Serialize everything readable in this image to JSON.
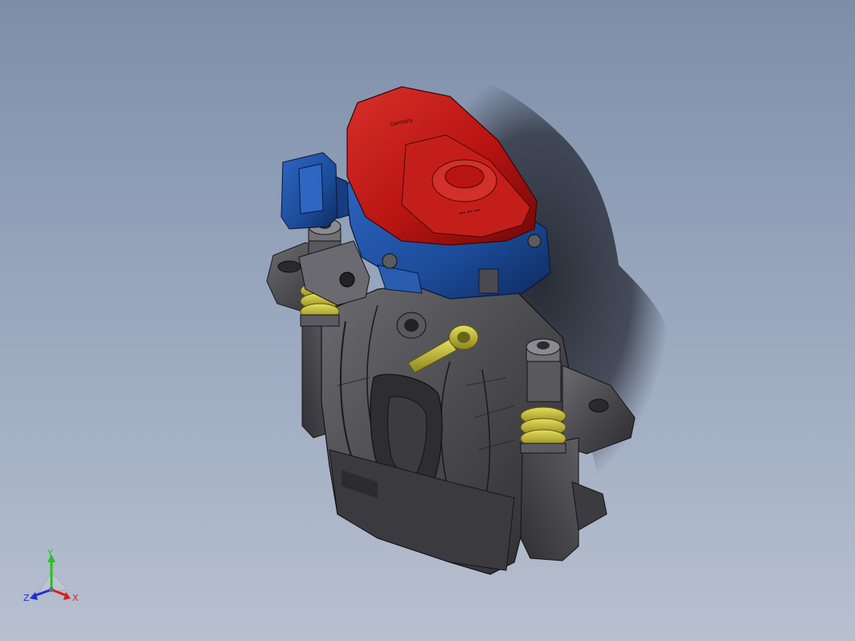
{
  "viewport": {
    "background_top": "#7d8ea8",
    "background_bottom": "#b7c0cf"
  },
  "model": {
    "parts": [
      "red-motor-cover",
      "blue-actuator-housing",
      "blue-connector",
      "dark-caliper-body",
      "yellow-bellows",
      "yellow-bleed-lever"
    ],
    "colors": {
      "cover": "#b81412",
      "housing": "#1c4c9a",
      "body": "#4a4a4e",
      "accent": "#cfc63a"
    },
    "cover_text_1": "Germany",
    "cover_text_2": "••• ••• •••"
  },
  "triad": {
    "y_label": "Y",
    "x_label": "X",
    "z_label": "Z",
    "y_color": "#22c422",
    "x_color": "#d42020",
    "z_color": "#2030d0"
  }
}
